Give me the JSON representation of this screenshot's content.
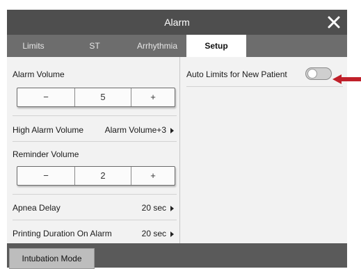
{
  "window": {
    "title": "Alarm",
    "close_icon": "close-icon"
  },
  "tabs": [
    {
      "label": "Limits",
      "active": false
    },
    {
      "label": "ST",
      "active": false
    },
    {
      "label": "Arrhythmia",
      "active": false
    },
    {
      "label": "Setup",
      "active": true
    }
  ],
  "left": {
    "alarm_volume": {
      "label": "Alarm Volume",
      "minus": "−",
      "value": "5",
      "plus": "+"
    },
    "high_alarm_volume": {
      "label": "High Alarm Volume",
      "value": "Alarm Volume+3"
    },
    "reminder_volume": {
      "label": "Reminder Volume",
      "minus": "−",
      "value": "2",
      "plus": "+"
    },
    "apnea_delay": {
      "label": "Apnea Delay",
      "value": "20 sec"
    },
    "printing_duration": {
      "label": "Printing Duration On Alarm",
      "value": "20 sec"
    }
  },
  "right": {
    "auto_limits": {
      "label": "Auto Limits for New Patient",
      "enabled": false
    }
  },
  "footer": {
    "button": "Intubation Mode"
  },
  "colors": {
    "titlebar": "#4e4e4e",
    "tabbar": "#6d6d6d",
    "footer": "#5a5a5a",
    "arrow": "#c0202a"
  }
}
